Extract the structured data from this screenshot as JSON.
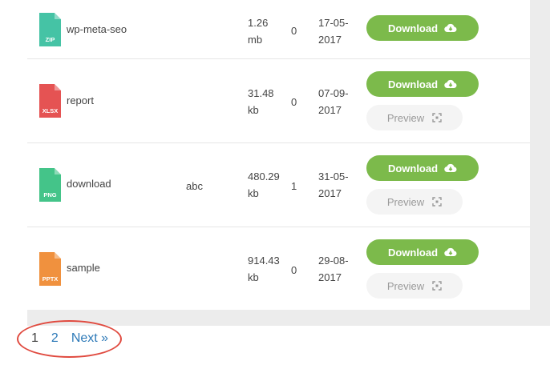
{
  "files": [
    {
      "name": "wp-meta-seo",
      "type": "ZIP",
      "color": "#45c3a5",
      "description": "",
      "size_value": "1.26",
      "size_unit": "mb",
      "hits": "0",
      "date_day": "17-05-",
      "date_year": "2017",
      "has_preview": false
    },
    {
      "name": "report",
      "type": "XLSX",
      "color": "#e55353",
      "description": "",
      "size_value": "31.48",
      "size_unit": "kb",
      "hits": "0",
      "date_day": "07-09-",
      "date_year": "2017",
      "has_preview": true
    },
    {
      "name": "download",
      "type": "PNG",
      "color": "#44c489",
      "description": "abc",
      "size_value": "480.29",
      "size_unit": "kb",
      "hits": "1",
      "date_day": "31-05-",
      "date_year": "2017",
      "has_preview": true
    },
    {
      "name": "sample",
      "type": "PPTX",
      "color": "#f0913e",
      "description": "",
      "size_value": "914.43",
      "size_unit": "kb",
      "hits": "0",
      "date_day": "29-08-",
      "date_year": "2017",
      "has_preview": true
    }
  ],
  "buttons": {
    "download_label": "Download",
    "preview_label": "Preview"
  },
  "pagination": {
    "current": "1",
    "page2": "2",
    "next": "Next »"
  },
  "colors": {
    "download_button": "#7cba4b",
    "link": "#2e7ab8",
    "annotation": "#e04a3f"
  },
  "icons": {
    "download": "cloud-download-icon",
    "preview": "preview-icon"
  }
}
